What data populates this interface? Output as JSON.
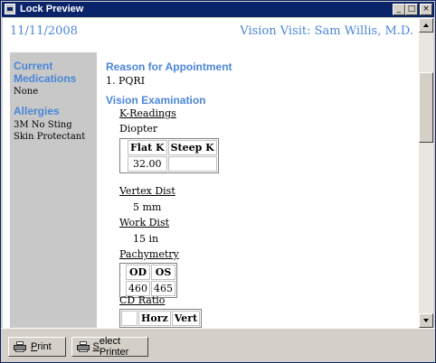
{
  "window": {
    "title": "Lock Preview"
  },
  "header": {
    "date": "11/11/2008",
    "visit": "Vision Visit: Sam Willis, M.D."
  },
  "sidebar": {
    "medications_heading_line1": "Current",
    "medications_heading_line2": "Medications",
    "medications_value": "None",
    "allergies_heading": "Allergies",
    "allergies_line1": "3M No Sting",
    "allergies_line2": "Skin Protectant"
  },
  "main": {
    "reason_heading": "Reason for Appointment",
    "reason_item": "1. PQRI",
    "exam_heading": "Vision Examination",
    "k_readings_label": "K-Readings",
    "diopter_label": "Diopter",
    "k_table": {
      "headers": [
        "Flat K",
        "Steep K"
      ],
      "row": [
        "32.00",
        ""
      ]
    },
    "vertex_label": "Vertex Dist",
    "vertex_value": "5 mm",
    "work_label": "Work Dist",
    "work_value": "15 in",
    "pachymetry_label": "Pachymetry",
    "pachy_table": {
      "headers": [
        "OD",
        "OS"
      ],
      "row": [
        "460",
        "465"
      ]
    },
    "cd_label": "CD Ratio",
    "cd_table": {
      "headers": [
        "",
        "Horz",
        "Vert"
      ]
    }
  },
  "footer": {
    "print_label_accel": "P",
    "print_label_rest": "rint",
    "select_label_accel": "S",
    "select_label_rest": "elect Printer"
  }
}
